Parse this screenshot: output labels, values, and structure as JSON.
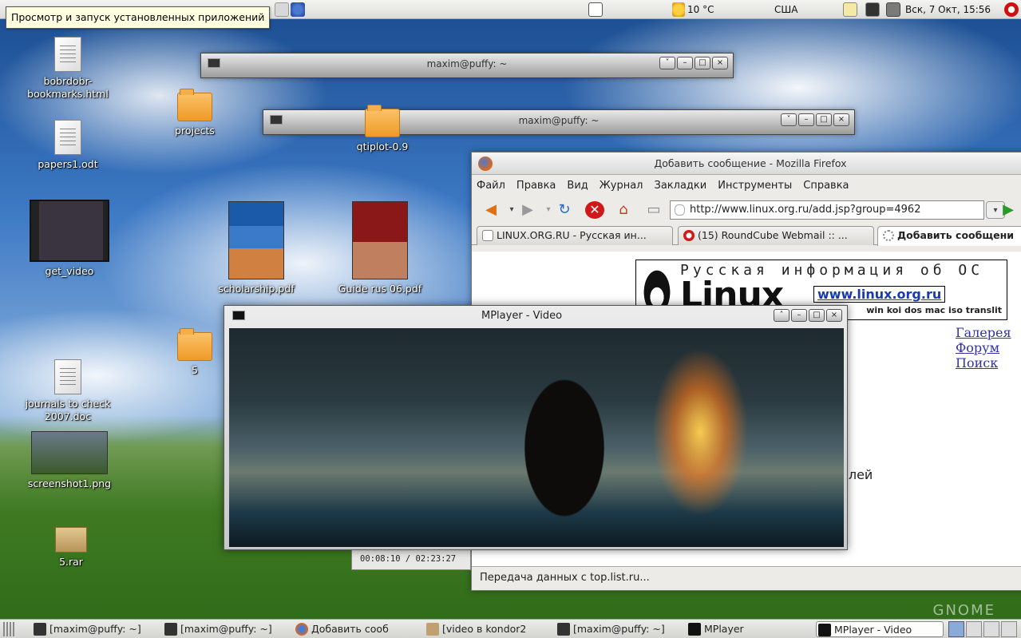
{
  "top_panel": {
    "tooltip": "Просмотр и запуск установленных приложений",
    "weather": "10 °C",
    "locale": "США",
    "clock": "Вск,  7 Окт, 15:56"
  },
  "desktop": {
    "icons": [
      {
        "label": "bobrdobr-\nbookmarks.html",
        "kind": "html"
      },
      {
        "label": "papers1.odt",
        "kind": "doc"
      },
      {
        "label": "get_video",
        "kind": "video"
      },
      {
        "label": "projects",
        "kind": "folder"
      },
      {
        "label": "qtiplot-0.9",
        "kind": "folder"
      },
      {
        "label": "scholarship.pdf",
        "kind": "pdf"
      },
      {
        "label": "Guide rus 06.pdf",
        "kind": "pdf"
      },
      {
        "label": "5",
        "kind": "folder"
      },
      {
        "label": "journals to check\n2007.doc",
        "kind": "doc"
      },
      {
        "label": "screenshot1.png",
        "kind": "image"
      },
      {
        "label": "5.rar",
        "kind": "archive"
      }
    ],
    "watermark": "GNOME"
  },
  "terminals": [
    {
      "title": "maxim@puffy: ~"
    },
    {
      "title": "maxim@puffy: ~"
    }
  ],
  "firefox": {
    "title": "Добавить сообщение - Mozilla Firefox",
    "menu": [
      "Файл",
      "Правка",
      "Вид",
      "Журнал",
      "Закладки",
      "Инструменты",
      "Справка"
    ],
    "url": "http://www.linux.org.ru/add.jsp?group=4962",
    "tabs": [
      {
        "label": "LINUX.ORG.RU - Русская ин..."
      },
      {
        "label": "(15) RoundCube Webmail :: ..."
      },
      {
        "label": "Добавить сообщени"
      }
    ],
    "status": "Передача данных с top.list.ru...",
    "page": {
      "banner_tagline": "Русская информация об ОС",
      "banner_logo": "Linux",
      "banner_url": "www.linux.org.ru",
      "banner_encodings": "win koi dos mac iso translit",
      "links": [
        "Галерея",
        "Форум",
        "Поиск"
      ],
      "partial_text": "елей"
    }
  },
  "mplayer": {
    "title": "MPlayer - Video",
    "time": "00:08:10  /  02:23:27"
  },
  "taskbar": {
    "tasks": [
      {
        "label": "[maxim@puffy: ~]"
      },
      {
        "label": "[maxim@puffy: ~]"
      },
      {
        "label": "Добавить сооб"
      },
      {
        "label": "[video в kondor2"
      },
      {
        "label": "[maxim@puffy: ~]"
      },
      {
        "label": "MPlayer"
      },
      {
        "label": "MPlayer - Video"
      }
    ]
  }
}
